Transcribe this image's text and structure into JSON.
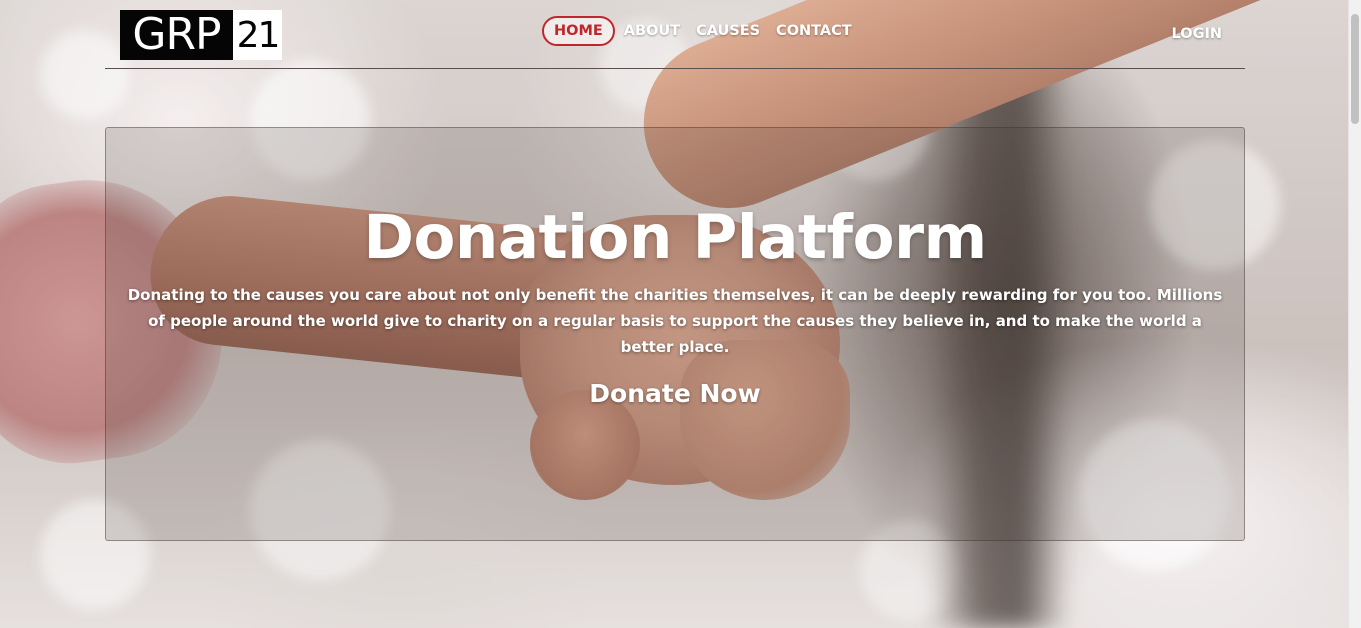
{
  "logo": {
    "left_text": "GRP",
    "right_text": "21"
  },
  "nav": {
    "items": [
      {
        "label": "HOME",
        "active": true
      },
      {
        "label": "ABOUT",
        "active": false
      },
      {
        "label": "CAUSES",
        "active": false
      },
      {
        "label": "CONTACT",
        "active": false
      }
    ],
    "login_label": "LOGIN"
  },
  "hero": {
    "title": "Donation Platform",
    "text": "Donating to the causes you care about not only benefit the charities themselves, it can be deeply rewarding for you too. Millions of people around the world give to charity on a regular basis to support the causes they believe in, and to make the world a better place.",
    "cta_label": "Donate Now"
  },
  "colors": {
    "accent": "#c0272d",
    "text_light": "#ffffff",
    "logo_dark": "#050505"
  }
}
